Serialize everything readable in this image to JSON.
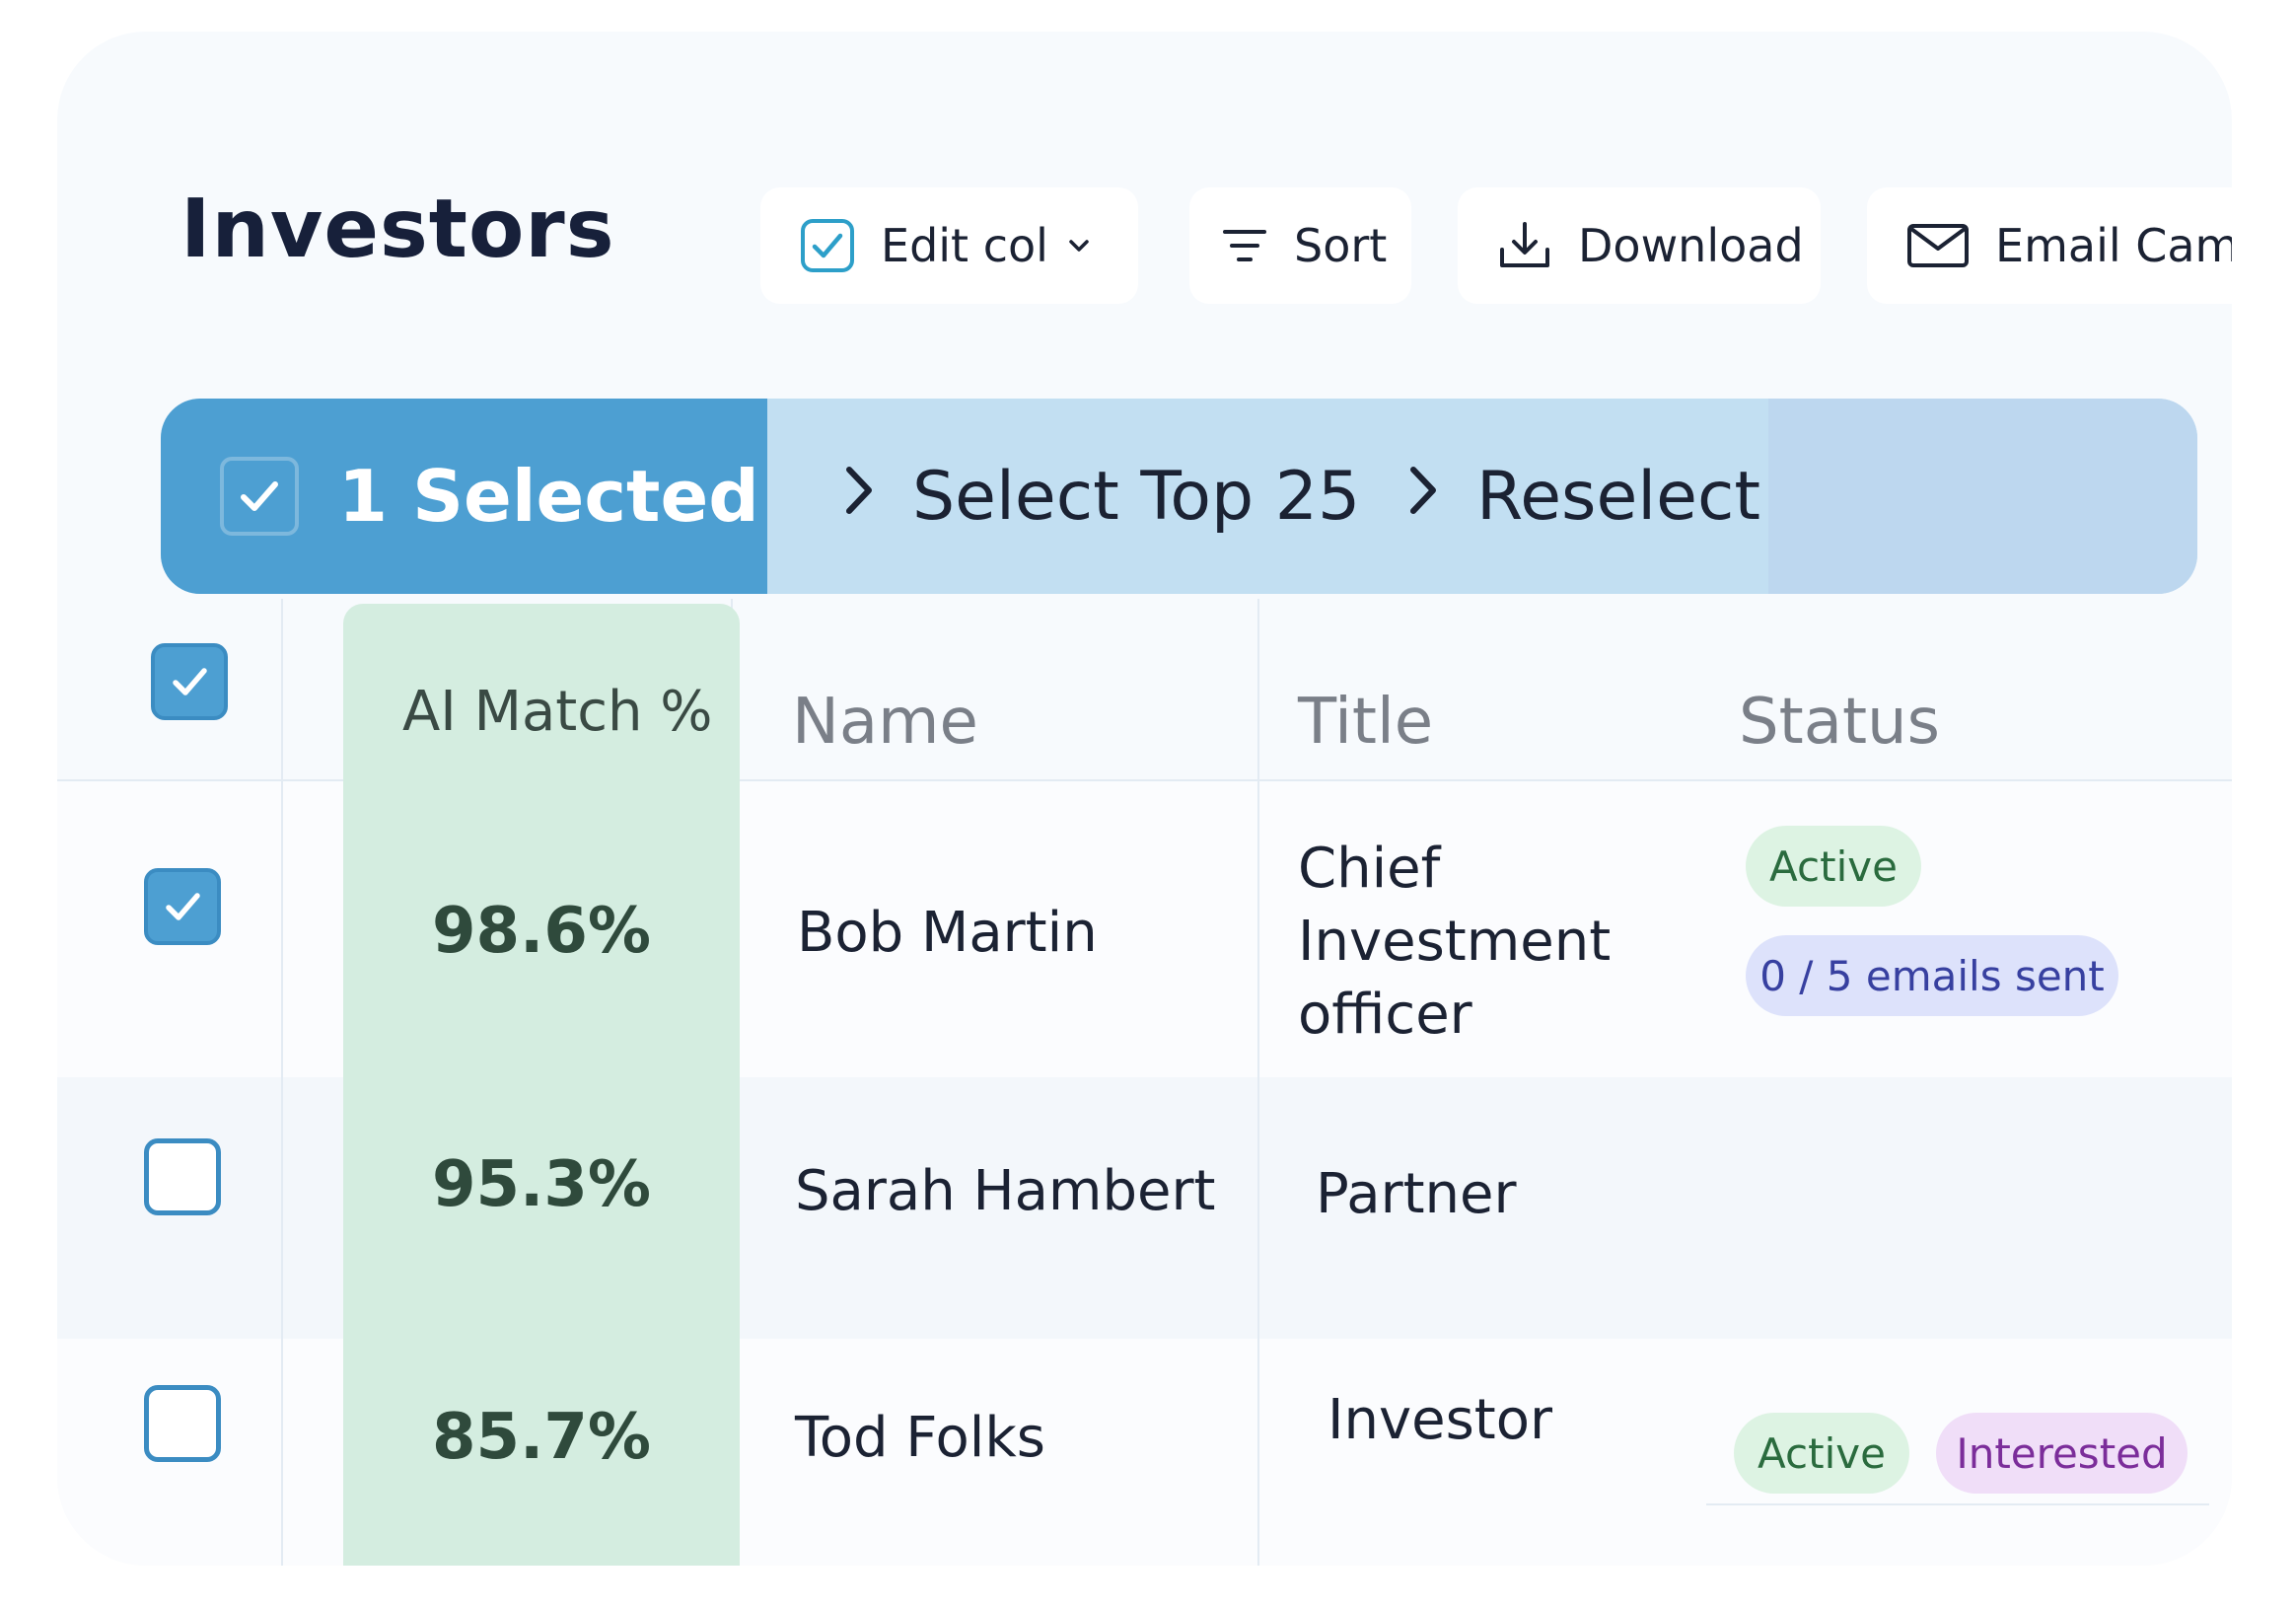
{
  "header": {
    "title": "Investors"
  },
  "toolbar": {
    "edit_col": "Edit col",
    "sort": "Sort",
    "download": "Download",
    "email_campaign": "Email Campaign"
  },
  "selection": {
    "count_label": "1 Selected",
    "select_top": "Select Top 25",
    "reselect": "Reselect"
  },
  "table": {
    "columns": {
      "match": "AI Match %",
      "name": "Name",
      "title": "Title",
      "status": "Status"
    },
    "rows": [
      {
        "checked": true,
        "match": "98.6%",
        "name": "Bob  Martin",
        "title": "Chief Investment officer",
        "badges": [
          "Active",
          "0 / 5 emails sent"
        ]
      },
      {
        "checked": false,
        "match": "95.3%",
        "name": "Sarah Hambert",
        "title": "Partner",
        "badges": []
      },
      {
        "checked": false,
        "match": "85.7%",
        "name": "Tod Folks",
        "title": "Investor",
        "badges": [
          "Active",
          "Interested"
        ]
      }
    ]
  },
  "colors": {
    "accent": "#4d9fd2",
    "selection_bar": "#c2dff2",
    "match_column": "#d4ede0",
    "badge_active": "#ddf3e3",
    "badge_emails": "#dde2fb",
    "badge_interested": "#f0def8"
  },
  "icons": [
    "checkbox-icon",
    "chevron-down-icon",
    "sort-icon",
    "download-icon",
    "mail-icon",
    "chevron-right-icon",
    "check-icon"
  ]
}
